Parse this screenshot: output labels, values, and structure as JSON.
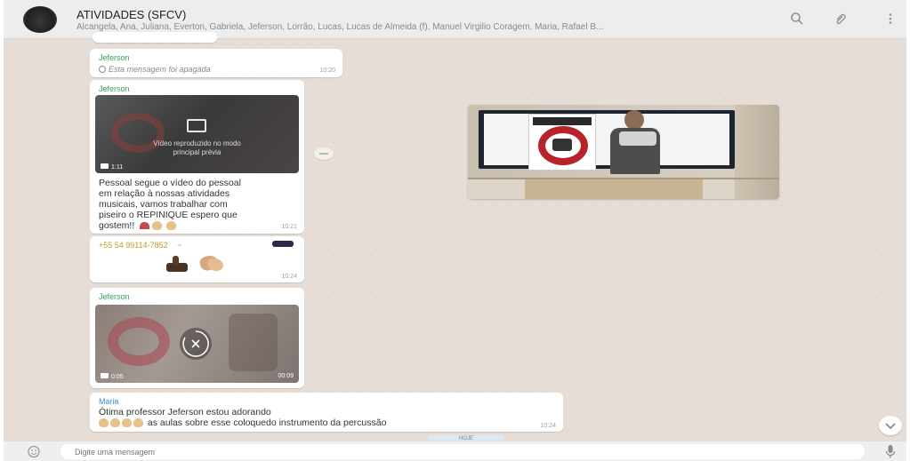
{
  "header": {
    "title": "ATIVIDADES (SFCV)",
    "members": "Alcangela, Ana, Juliana, Everton, Gabriela, Jeferson, Lorrão, Lucas, Lucas de Almeida (f), Manuel Virgilio Coragem, Maria, Rafael B..."
  },
  "messages": [
    {
      "sender": "Jeferson",
      "text": "Esta mensagem foi apagada",
      "time": "10:20"
    },
    {
      "sender": "Jeferson",
      "video_caption": "Vídeo reproduzido no modo",
      "video_caption2": "principal prévia",
      "duration": "1:11",
      "lines": [
        "Pessoal segue o vídeo do pessoal",
        "em relação à nossas atividades",
        "musicais, vamos trabalhar com",
        "piseiro o REPINIQUE espero que",
        "gostem!!"
      ],
      "time": "10:21"
    },
    {
      "sender": "+55 54 99114-7852",
      "sender_suffix": "~",
      "time": "10:24"
    },
    {
      "sender": "Jeferson",
      "duration": "0:05",
      "size": "00:09"
    },
    {
      "sender": "Maria",
      "lines": [
        "Ótima professor Jeferson estou adorando",
        "as aulas sobre esse coloquedo instrumento da percussão"
      ],
      "time": "10:24"
    }
  ],
  "date_chip": "HOJE",
  "composer": {
    "placeholder": "Digite uma mensagem"
  },
  "colors": {
    "accent": "#35a35a",
    "background": "#e6ded6",
    "header": "#ededed"
  }
}
